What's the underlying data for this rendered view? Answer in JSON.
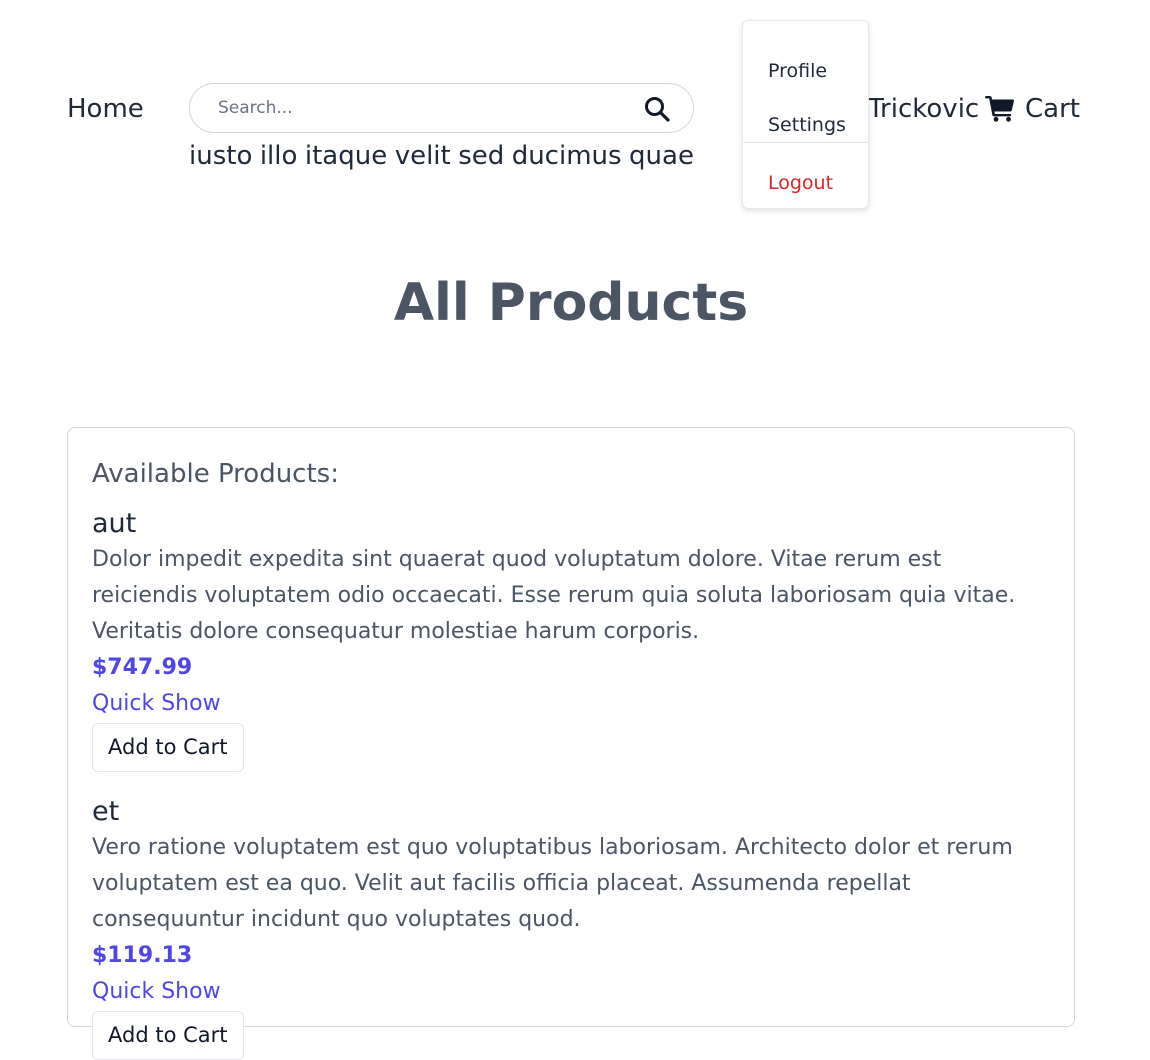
{
  "header": {
    "home_label": "Home",
    "search_placeholder": "Search...",
    "search_tags": [
      "iusto",
      "illo",
      "itaque",
      "velit",
      "sed",
      "ducimus",
      "quae"
    ],
    "user_name": "Trickovic",
    "cart_label": "Cart"
  },
  "dropdown": {
    "items": [
      {
        "label": "Profile",
        "color": "#1f2937"
      },
      {
        "label": "Settings",
        "color": "#1f2937"
      },
      {
        "label": "Logout",
        "color": "#dc2626"
      }
    ]
  },
  "page_title": "All Products",
  "products_panel": {
    "heading": "Available Products:",
    "products": [
      {
        "name": "aut",
        "description": "Dolor impedit expedita sint quaerat quod voluptatum dolore. Vitae rerum est reiciendis voluptatem odio occaecati. Esse rerum quia soluta laboriosam quia vitae. Veritatis dolore consequatur molestiae harum corporis.",
        "price": "$747.99",
        "quick_show_label": "Quick Show",
        "add_to_cart_label": "Add to Cart"
      },
      {
        "name": "et",
        "description": "Vero ratione voluptatem est quo voluptatibus laboriosam. Architecto dolor et rerum voluptatem est ea quo. Velit aut facilis officia placeat. Assumenda repellat consequuntur incidunt quo voluptates quod.",
        "price": "$119.13",
        "quick_show_label": "Quick Show",
        "add_to_cart_label": "Add to Cart"
      }
    ]
  },
  "colors": {
    "accent": "#4f46e5",
    "danger": "#dc2626",
    "text_dark": "#1f2937",
    "border": "#d1d5db"
  },
  "icons": {
    "search": "search-icon",
    "cart": "cart-icon"
  }
}
